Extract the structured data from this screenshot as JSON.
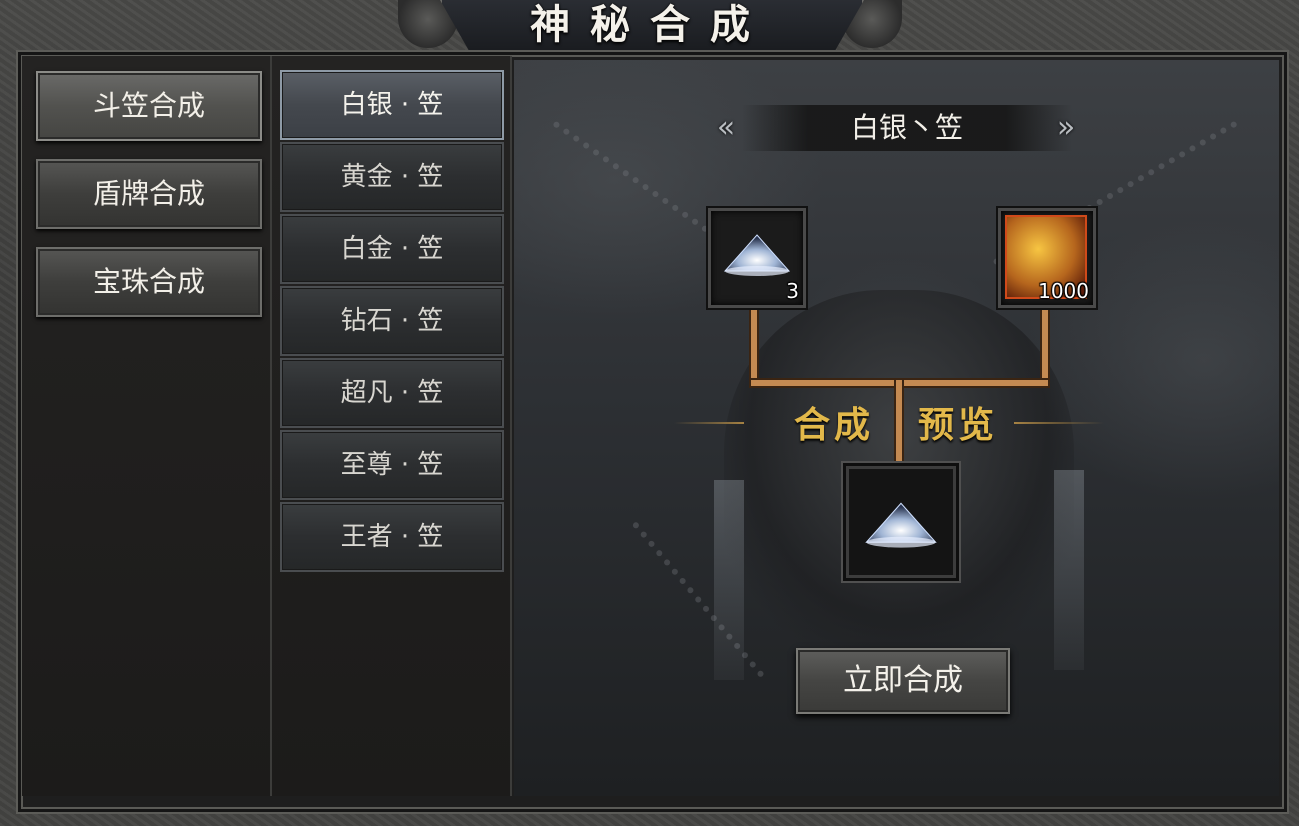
{
  "window": {
    "title": "神秘合成"
  },
  "categories": [
    {
      "label": "斗笠合成",
      "active": true
    },
    {
      "label": "盾牌合成",
      "active": false
    },
    {
      "label": "宝珠合成",
      "active": false
    }
  ],
  "items": [
    {
      "label": "白银 · 笠",
      "active": true
    },
    {
      "label": "黄金 · 笠",
      "active": false
    },
    {
      "label": "白金 · 笠",
      "active": false
    },
    {
      "label": "钻石 · 笠",
      "active": false
    },
    {
      "label": "超凡 · 笠",
      "active": false
    },
    {
      "label": "至尊 · 笠",
      "active": false
    },
    {
      "label": "王者 · 笠",
      "active": false
    }
  ],
  "selector": {
    "prev_icon": "«",
    "next_icon": "»",
    "current": "白银丶笠"
  },
  "materials": [
    {
      "icon": "hat-icon",
      "quantity": "3"
    },
    {
      "icon": "gold-icon",
      "quantity": "1000"
    }
  ],
  "preview": {
    "left_label": "合成",
    "right_label": "预览",
    "result_icon": "hat-icon"
  },
  "actions": {
    "craft_label": "立即合成"
  },
  "colors": {
    "connector": "#c48a52",
    "preview_text": "#e2b84a",
    "active_item_border": "#8e9aa6"
  }
}
